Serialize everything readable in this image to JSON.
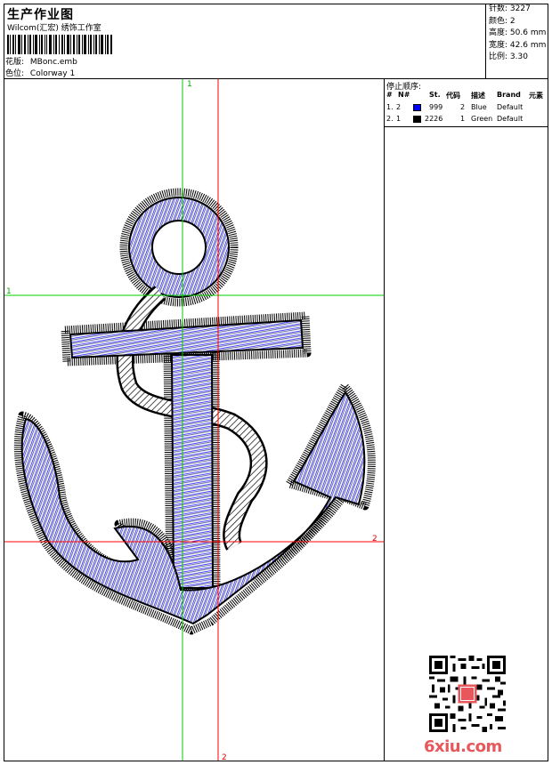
{
  "header": {
    "title": "生产作业图",
    "studio": "Wilcom(汇宏) 绣饰工作室",
    "design_label": "花版:",
    "design_value": "MBonc.emb",
    "colorway_label": "色位:",
    "colorway_value": "Colorway 1"
  },
  "stats": [
    {
      "label": "针数:",
      "value": "3227"
    },
    {
      "label": "颜色:",
      "value": "2"
    },
    {
      "label": "高度:",
      "value": "50.6 mm"
    },
    {
      "label": "宽度:",
      "value": "42.6 mm"
    },
    {
      "label": "比例:",
      "value": "3.30"
    }
  ],
  "stop_sequence": {
    "title": "停止顺序:",
    "columns": [
      "#",
      "N#",
      "St.",
      "代码",
      "描述",
      "Brand",
      "元素"
    ],
    "rows": [
      {
        "index": "1.",
        "n": "2",
        "color": "#0000ff",
        "st": "999",
        "code": "2",
        "desc": "Blue",
        "brand": "Default"
      },
      {
        "index": "2.",
        "n": "1",
        "color": "#000000",
        "st": "2226",
        "code": "1",
        "desc": "Green",
        "brand": "Default"
      }
    ]
  },
  "guides": {
    "green_v": "1",
    "green_h": "1",
    "red_v": "2",
    "red_h": "2"
  },
  "colors": {
    "thread_blue": "#1a1aff",
    "thread_black": "#000000",
    "guide_green": "#00cc00",
    "guide_red": "#ff0000",
    "logo": "#e8575b"
  },
  "watermark": "6xiu.com"
}
